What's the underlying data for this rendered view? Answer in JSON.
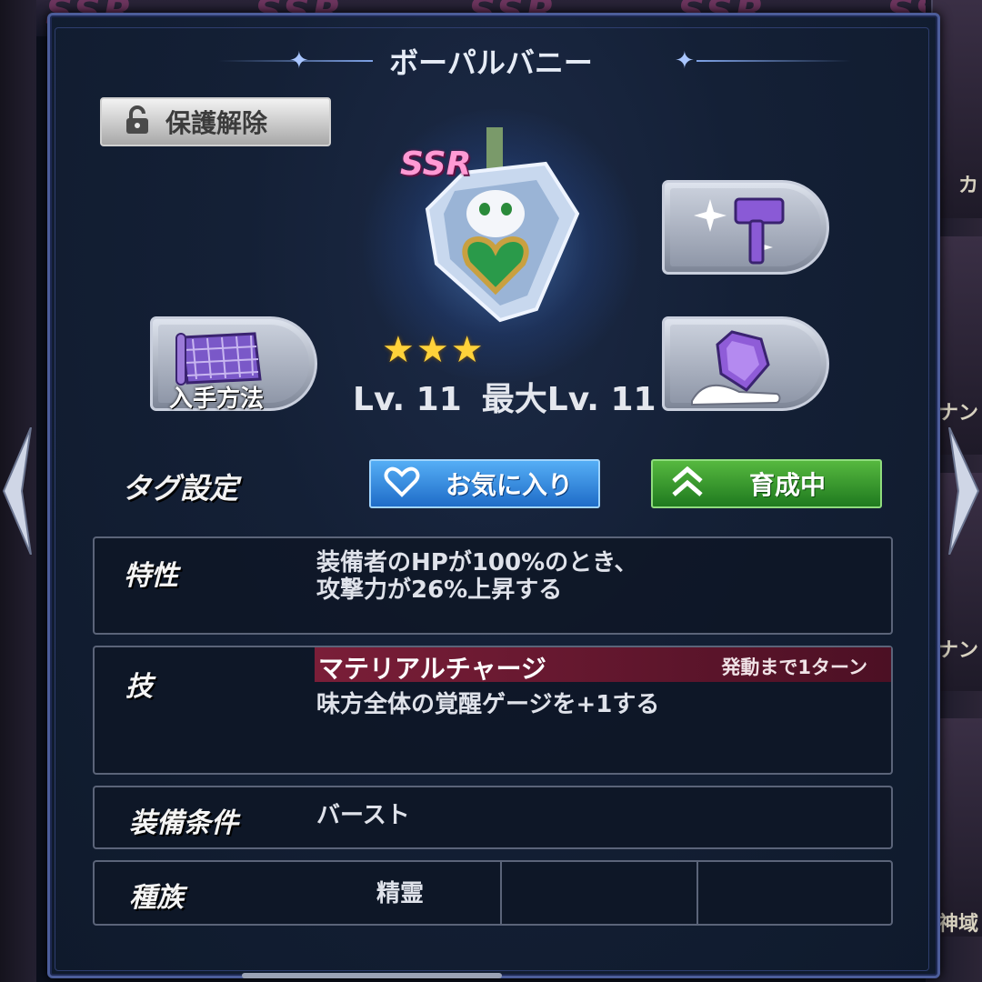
{
  "title": "ボーパルバニー",
  "protect_button": {
    "label": "保護解除",
    "icon": "unlock-icon"
  },
  "item": {
    "rarity": "SSR",
    "stars": "★★★",
    "star_count": 3,
    "level_text": "Lv. 11",
    "max_level_text": "最大Lv. 11"
  },
  "buttons": {
    "acquire_label": "入手方法",
    "acquire_icon": "map-scroll-icon",
    "enhance_icon": "hammer-sparkle-icon",
    "gem_icon": "gem-hand-icon"
  },
  "tags": {
    "label": "タグ設定",
    "favorite": "お気に入り",
    "training": "育成中"
  },
  "trait": {
    "label": "特性",
    "line1": "装備者のHPが100%のとき、",
    "line2": "攻撃力が26%上昇する"
  },
  "skill": {
    "label": "技",
    "name": "マテリアルチャージ",
    "turns": "発動まで1ターン",
    "description": "味方全体の覚醒ゲージを+1する"
  },
  "equip_condition": {
    "label": "装備条件",
    "value": "バースト"
  },
  "tribe": {
    "label": "種族",
    "values": [
      "精霊",
      "",
      ""
    ]
  },
  "background": {
    "ssr_text": "SSR",
    "side_labels": [
      "カ",
      "ナン",
      "ナン",
      "神域"
    ]
  },
  "colors": {
    "panel_border": "#4c5d9a",
    "favorite": "#3a8ee0",
    "training": "#3a9a2e",
    "skill_bar": "#7a1e38",
    "ssr": "#ff9ad4",
    "star": "#ffd23a"
  }
}
